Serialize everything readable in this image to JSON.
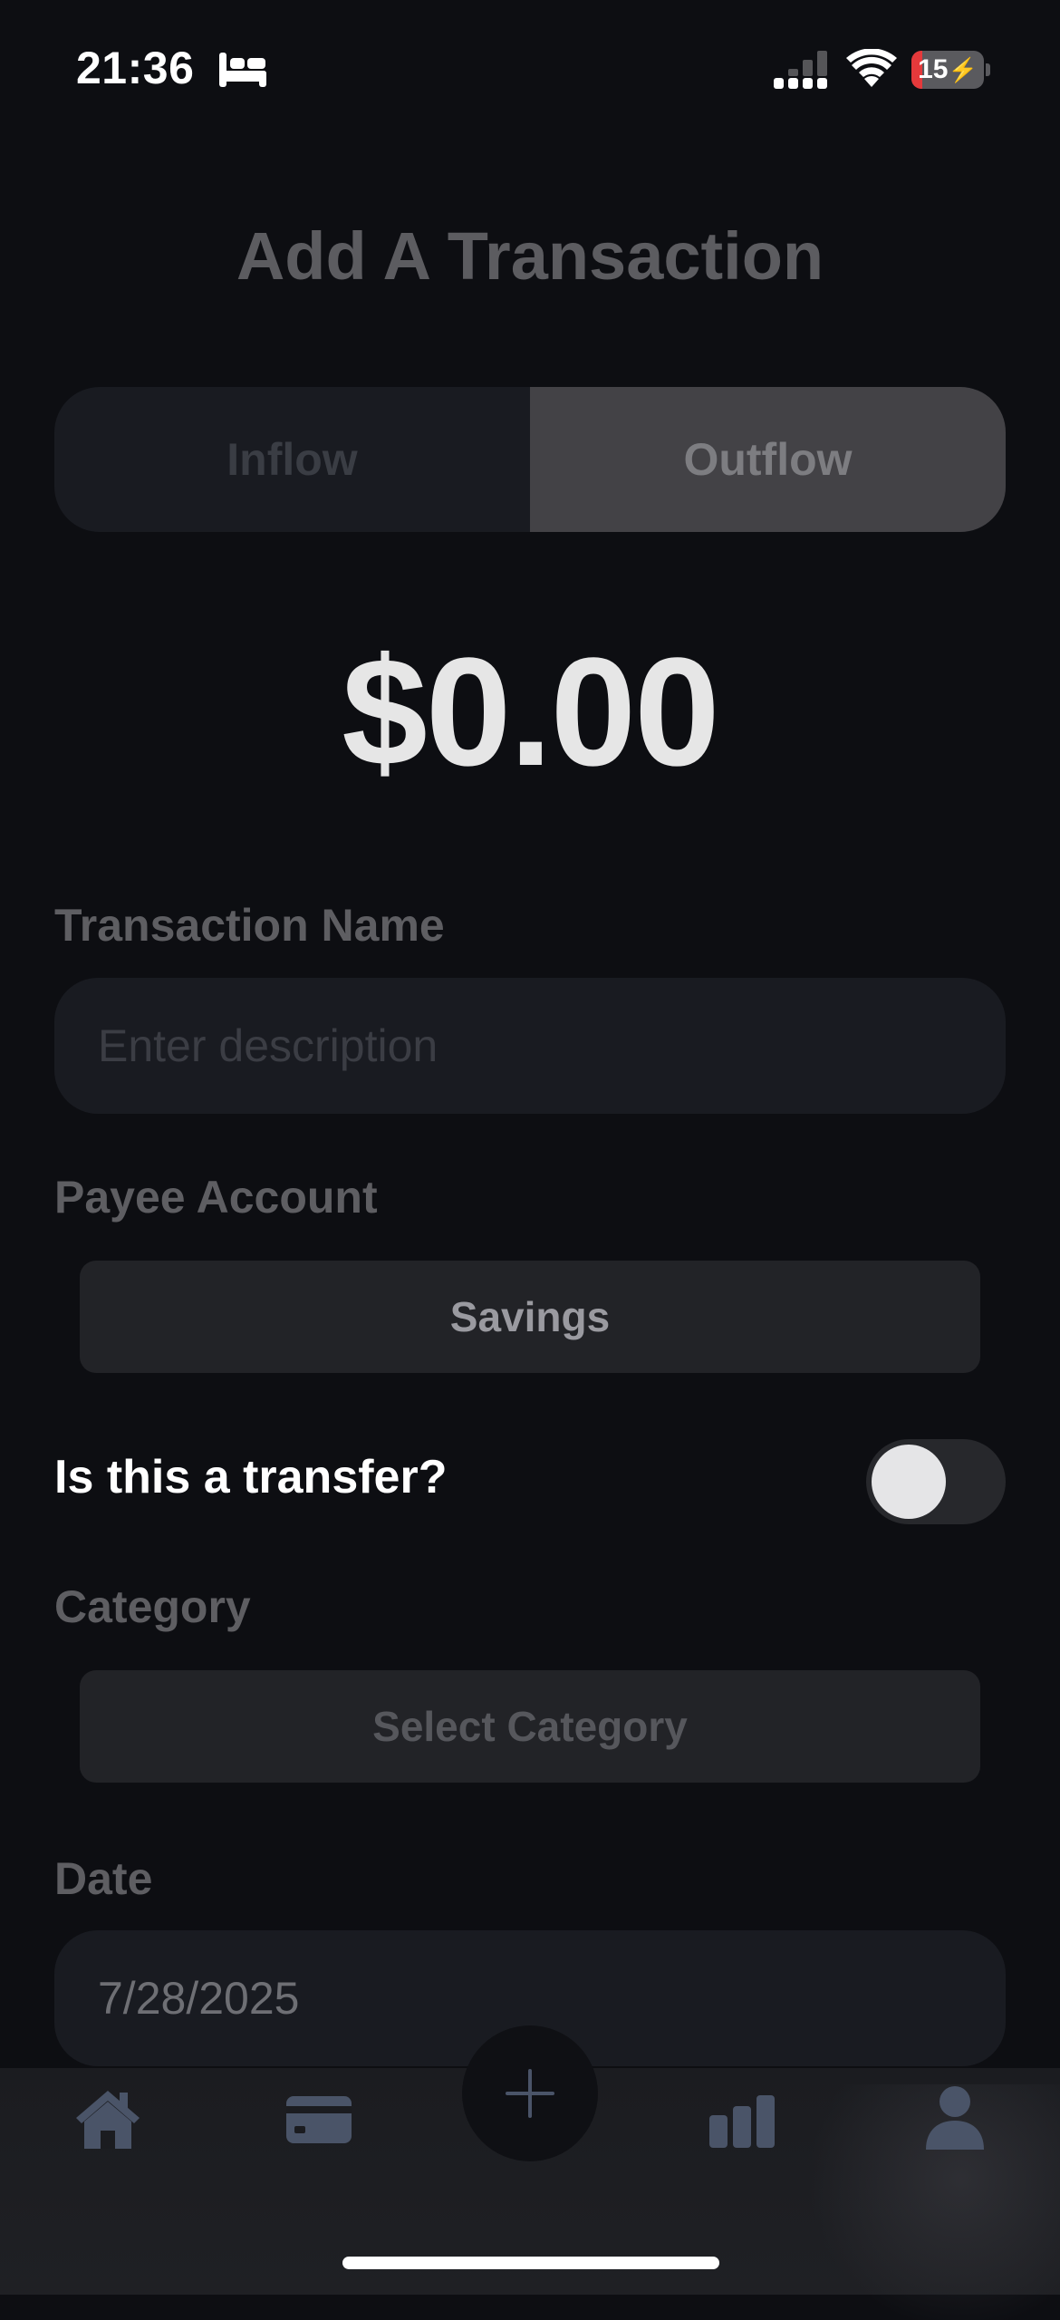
{
  "status_bar": {
    "time": "21:36",
    "battery_level": "15",
    "battery_fraction": 0.15,
    "icons": [
      "bed-icon",
      "cellular-signal-icon",
      "wifi-icon",
      "battery-charging-icon"
    ]
  },
  "header": {
    "title": "Add A Transaction"
  },
  "flow_toggle": {
    "options": [
      "Inflow",
      "Outflow"
    ],
    "selected": "Outflow"
  },
  "amount": "$0.00",
  "form": {
    "transaction_name": {
      "label": "Transaction Name",
      "placeholder": "Enter description",
      "value": ""
    },
    "payee_account": {
      "label": "Payee Account",
      "value": "Savings"
    },
    "transfer": {
      "label": "Is this a transfer?",
      "on": false
    },
    "category": {
      "label": "Category",
      "value": "Select Category"
    },
    "date": {
      "label": "Date",
      "value": "7/28/2025"
    }
  },
  "tab_bar": {
    "items": [
      "home-icon",
      "credit-card-icon",
      "add-icon",
      "bar-chart-icon",
      "profile-icon"
    ]
  },
  "colors": {
    "background": "#0d0e12",
    "field": "#191b21",
    "segment_selected": "#434246",
    "battery_low": "#e5393b"
  }
}
